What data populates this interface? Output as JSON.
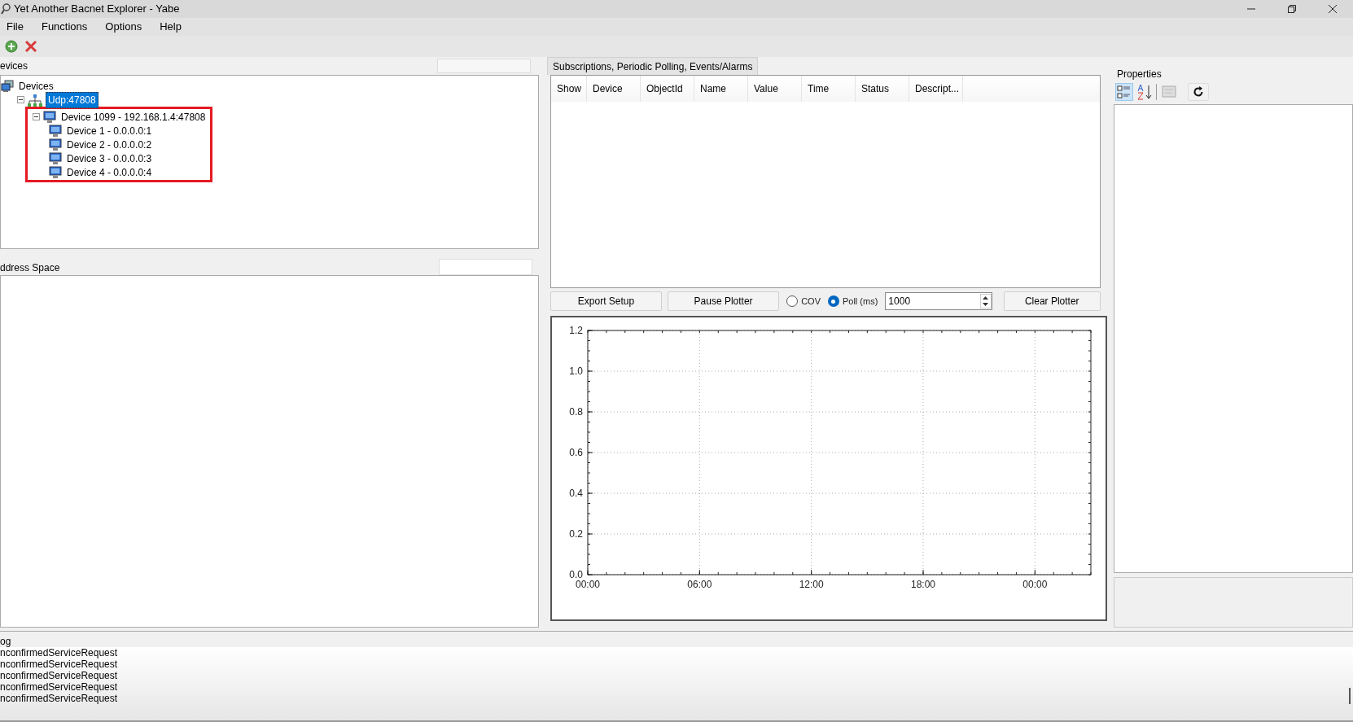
{
  "window": {
    "title": "Yet Another Bacnet Explorer - Yabe"
  },
  "menu": [
    "File",
    "Functions",
    "Options",
    "Help"
  ],
  "devices_panel": {
    "title": "evices",
    "tree": [
      {
        "label": "Devices",
        "kind": "root",
        "selected": false,
        "children": [
          {
            "label": "Udp:47808",
            "kind": "network",
            "selected": true,
            "expanded": true,
            "children": [
              {
                "label": "Device 1099 - 192.168.1.4:47808",
                "kind": "device",
                "selected": false,
                "expanded": true,
                "highlighted": true,
                "children": [
                  {
                    "label": "Device 1 - 0.0.0.0:1",
                    "kind": "device",
                    "selected": false
                  },
                  {
                    "label": "Device 2 - 0.0.0.0:2",
                    "kind": "device",
                    "selected": false
                  },
                  {
                    "label": "Device 3 - 0.0.0.0:3",
                    "kind": "device",
                    "selected": false
                  },
                  {
                    "label": "Device 4 - 0.0.0.0:4",
                    "kind": "device",
                    "selected": false
                  }
                ]
              }
            ]
          }
        ]
      }
    ]
  },
  "address_space": {
    "title": "ddress Space"
  },
  "subscriptions": {
    "tab": "Subscriptions, Periodic Polling, Events/Alarms",
    "columns": [
      "Show",
      "Device",
      "ObjectId",
      "Name",
      "Value",
      "Time",
      "Status",
      "Descript..."
    ]
  },
  "plotter_controls": {
    "export_button": "Export Setup",
    "pause_button": "Pause Plotter",
    "modes": [
      {
        "label": "COV",
        "selected": false
      },
      {
        "label": "Poll (ms)",
        "selected": true
      }
    ],
    "poll_value": "1000",
    "clear_button": "Clear Plotter"
  },
  "plot": {
    "chart_data": {
      "type": "line",
      "grid": true,
      "xlim": [
        0,
        27
      ],
      "ylim": [
        0,
        1.2
      ],
      "xticks": [
        {
          "value": 0,
          "label": "00:00"
        },
        {
          "value": 6,
          "label": "06:00"
        },
        {
          "value": 12,
          "label": "12:00"
        },
        {
          "value": 18,
          "label": "18:00"
        },
        {
          "value": 24,
          "label": "00:00"
        }
      ],
      "yticks": [
        {
          "value": 0,
          "label": "0.0"
        },
        {
          "value": 0.2,
          "label": "0.2"
        },
        {
          "value": 0.4,
          "label": "0.4"
        },
        {
          "value": 0.6,
          "label": "0.6"
        },
        {
          "value": 0.8,
          "label": "0.8"
        },
        {
          "value": 1.0,
          "label": "1.0"
        },
        {
          "value": 1.2,
          "label": "1.2"
        }
      ]
    }
  },
  "properties": {
    "title": "Properties"
  },
  "log": {
    "title": "og",
    "lines": [
      "nconfirmedServiceRequest",
      "nconfirmedServiceRequest",
      "nconfirmedServiceRequest",
      "nconfirmedServiceRequest",
      "nconfirmedServiceRequest"
    ]
  }
}
